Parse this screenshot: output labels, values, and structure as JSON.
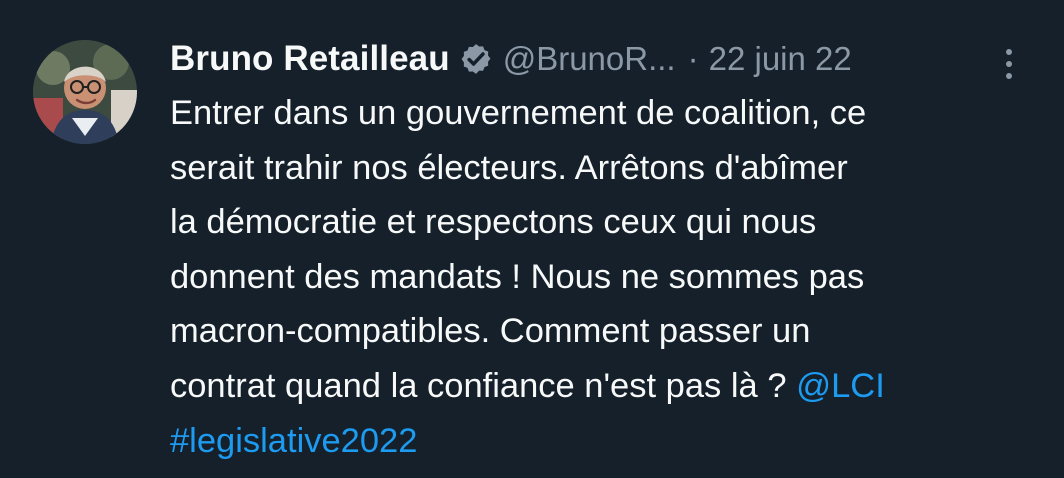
{
  "top_partial_text": "",
  "author": {
    "display_name": "Bruno Retailleau",
    "handle": "@BrunoR...",
    "verified": true
  },
  "tweet": {
    "separator": "·",
    "date": "22 juin 22",
    "text_lines": [
      "Entrer dans un gouvernement de coalition, ce",
      "serait trahir nos électeurs. Arrêtons d'abîmer",
      "la démocratie et respectons ceux qui nous",
      "donnent des mandats ! Nous ne sommes pas",
      "macron-compatibles. Comment passer un",
      "contrat quand la confiance n'est pas là ? "
    ],
    "mention": "@LCI",
    "hashtag": "#legislative2022"
  },
  "icons": {
    "verified": "verified-badge-icon",
    "more": "more-options-icon"
  },
  "colors": {
    "background": "#15202b",
    "primary_text": "#f7f9f9",
    "secondary_text": "#8b98a5",
    "link": "#1d9bf0",
    "verified_badge": "#8b98a5"
  }
}
